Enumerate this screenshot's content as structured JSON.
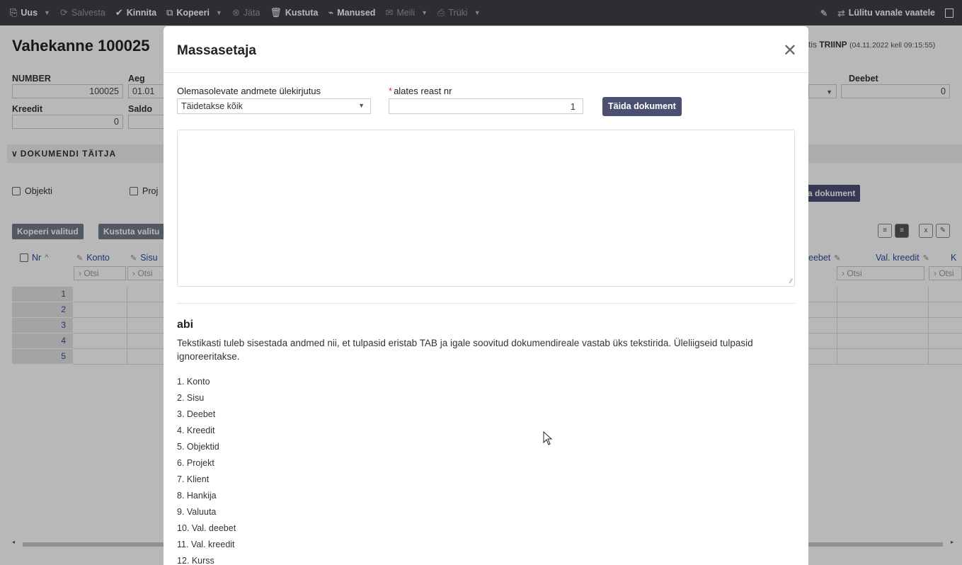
{
  "toolbar": {
    "items": [
      {
        "icon": "new-doc-icon",
        "label": "Uus",
        "caret": true,
        "dim": false
      },
      {
        "icon": "save-icon",
        "label": "Salvesta",
        "caret": false,
        "dim": true
      },
      {
        "icon": "check-icon",
        "label": "Kinnita",
        "caret": false,
        "dim": false
      },
      {
        "icon": "copy-icon",
        "label": "Kopeeri",
        "caret": true,
        "dim": false
      },
      {
        "icon": "cancel-icon",
        "label": "Jäta",
        "caret": false,
        "dim": true
      },
      {
        "icon": "trash-icon",
        "label": "Kustuta",
        "caret": false,
        "dim": false
      },
      {
        "icon": "paperclip-icon",
        "label": "Manused",
        "caret": false,
        "dim": false
      },
      {
        "icon": "mail-icon",
        "label": "Meili",
        "caret": true,
        "dim": true
      },
      {
        "icon": "print-icon",
        "label": "Trüki",
        "caret": true,
        "dim": true
      }
    ],
    "switch_label": "Lülitu vanale vaatele"
  },
  "background": {
    "title": "Vahekanne 100025",
    "saved_prefix": "tis",
    "saved_user": "TRIINP",
    "saved_time": "(04.11.2022 kell 09:15:55)",
    "labels": {
      "number": "NUMBER",
      "aeg": "Aeg",
      "kreedit": "Kreedit",
      "saldo": "Saldo",
      "deebet": "Deebet"
    },
    "values": {
      "number": "100025",
      "aeg": "01.01",
      "kreedit": "0",
      "deebet": "0"
    },
    "section": "DOKUMENDI TÄITJA",
    "checkboxes": {
      "objekti": "Objekti",
      "proj": "Proj"
    },
    "buttons": {
      "copy_selected": "Kopeeri valitud",
      "delete_selected": "Kustuta valitu",
      "fill_doc_partial": "a dokument"
    },
    "columns": {
      "nr": "Nr",
      "konto": "Konto",
      "sisu": "Sisu",
      "deebet_partial": "eebet",
      "val_kreedit": "Val. kreedit",
      "k_partial": "K"
    },
    "search_placeholder": "Otsi",
    "rows": [
      "1",
      "2",
      "3",
      "4",
      "5"
    ]
  },
  "modal": {
    "title": "Massasetaja",
    "overwrite_label": "Olemasolevate andmete ülekirjutus",
    "overwrite_value": "Täidetakse kõik",
    "from_row_label": "alates reast nr",
    "from_row_value": "1",
    "fill_button": "Täida dokument",
    "help_title": "abi",
    "help_text": "Tekstikasti tuleb sisestada andmed nii, et tulpasid eristab TAB ja igale soovitud dokumendireale vastab üks tekstirida. Üleliigseid tulpasid ignoreeritakse.",
    "fields": [
      "1. Konto",
      "2. Sisu",
      "3. Deebet",
      "4. Kreedit",
      "5. Objektid",
      "6. Projekt",
      "7. Klient",
      "8. Hankija",
      "9. Valuuta",
      "10. Val. deebet",
      "11. Val. kreedit",
      "12. Kurss"
    ]
  }
}
